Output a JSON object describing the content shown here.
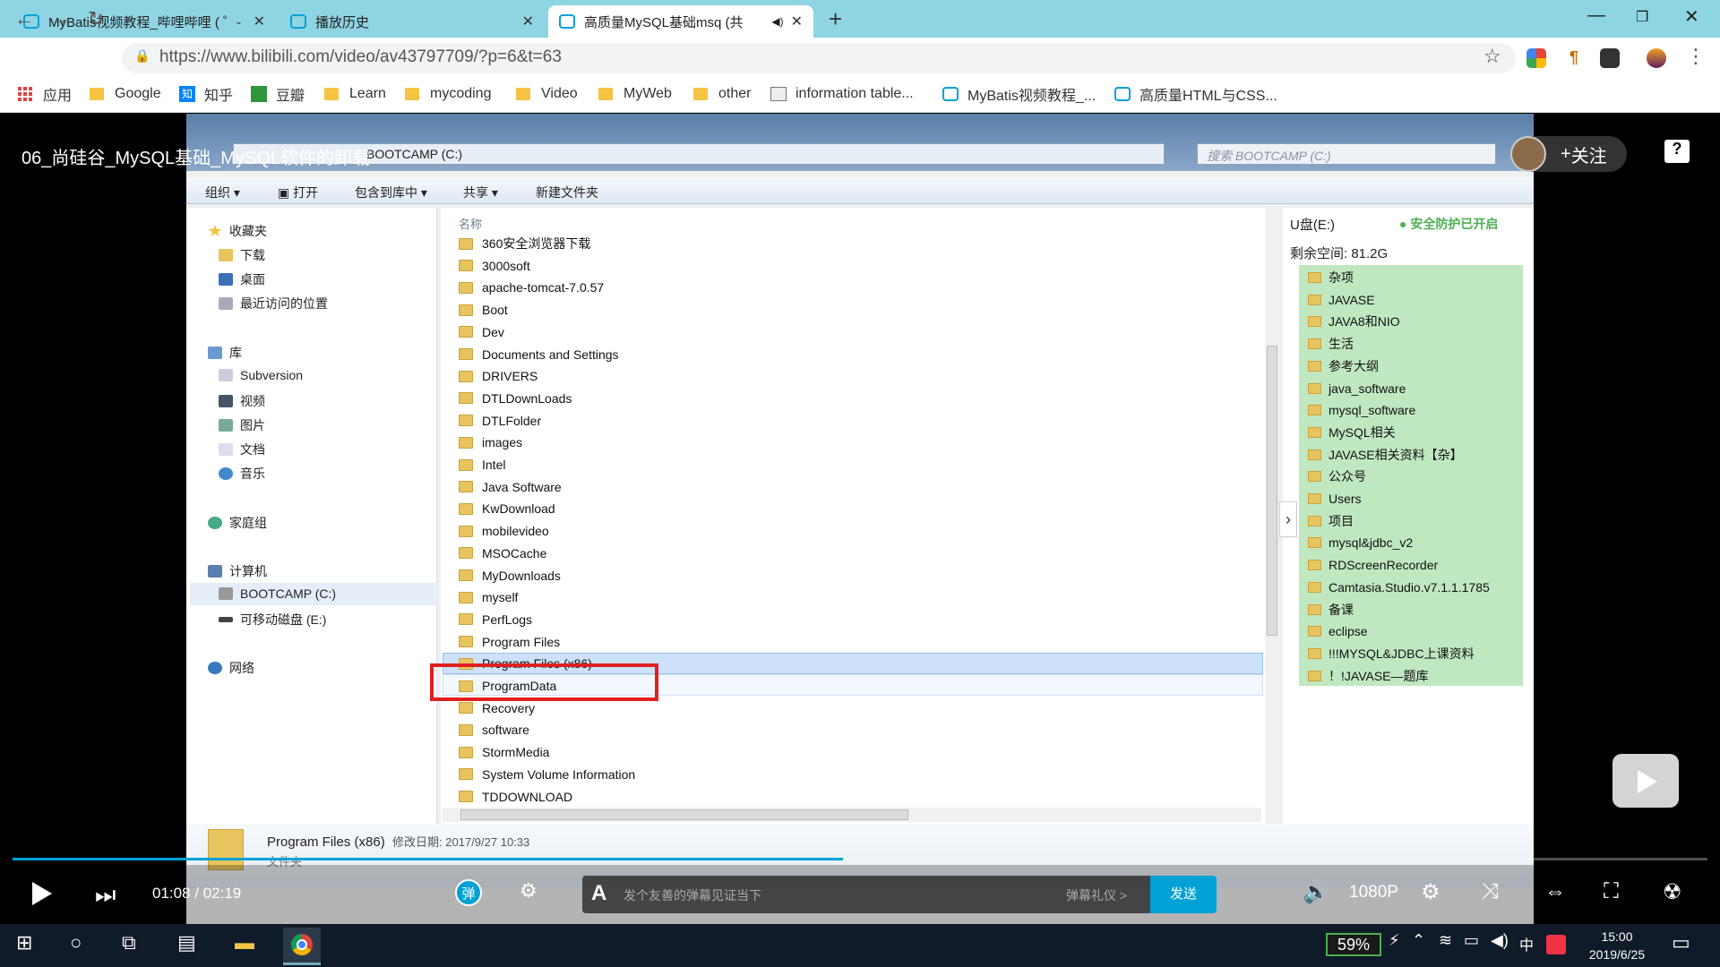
{
  "browser": {
    "tabs": [
      {
        "label": "MyBatis视频教程_哔哩哔哩 ( ゜-"
      },
      {
        "label": "播放历史"
      },
      {
        "label": "高质量MySQL基础msq (共"
      }
    ],
    "url": "https://www.bilibili.com/video/av43797709/?p=6&t=63",
    "bookmarks": [
      "应用",
      "Google",
      "知乎",
      "豆瓣",
      "Learn",
      "mycoding",
      "Video",
      "MyWeb",
      "other",
      "information table...",
      "MyBatis视频教程_...",
      "高质量HTML与CSS..."
    ]
  },
  "player": {
    "title": "06_尚硅谷_MySQL基础_MySQL软件的卸载",
    "follow_label": "关注",
    "help_label": "?",
    "time": "01:08 / 02:19",
    "progress": 0.49,
    "danmu_label": "弹",
    "danmu_placeholder": "发个友善的弹幕见证当下",
    "danmu_gift": "弹幕礼仪 >",
    "send_label": "发送",
    "quality": "1080P"
  },
  "explorer": {
    "address": "BOOTCAMP (C:)",
    "search_placeholder": "搜索 BOOTCAMP (C:)",
    "commands": [
      "组织 ▾",
      "打开",
      "包含到库中 ▾",
      "共享 ▾",
      "新建文件夹"
    ],
    "nav": {
      "favorites": "收藏夹",
      "fav_items": [
        "下载",
        "桌面",
        "最近访问的位置"
      ],
      "libraries": "库",
      "lib_items": [
        "Subversion",
        "视频",
        "图片",
        "文档",
        "音乐"
      ],
      "homegroup": "家庭组",
      "computer": "计算机",
      "drives": [
        "BOOTCAMP (C:)",
        "可移动磁盘 (E:)"
      ],
      "network": "网络"
    },
    "column_name": "名称",
    "files": [
      "360安全浏览器下载",
      "3000soft",
      "apache-tomcat-7.0.57",
      "Boot",
      "Dev",
      "Documents and Settings",
      "DRIVERS",
      "DTLDownLoads",
      "DTLFolder",
      "images",
      "Intel",
      "Java Software",
      "KwDownload",
      "mobilevideo",
      "MSOCache",
      "MyDownloads",
      "myself",
      "PerfLogs",
      "Program Files",
      "Program Files (x86)",
      "ProgramData",
      "Recovery",
      "software",
      "StormMedia",
      "System Volume Information",
      "TDDOWNLOAD"
    ],
    "detail_name": "Program Files (x86)",
    "detail_date": "修改日期: 2017/9/27 10:33",
    "detail_type": "文件夹"
  },
  "usb_panel": {
    "label": "U盘(E:)",
    "safe": "安全防护已开启",
    "space": "剩余空间: 81.2G",
    "items": [
      "杂项",
      "JAVASE",
      "JAVA8和NIO",
      "生活",
      "参考大纲",
      "java_software",
      "mysql_software",
      "MySQL相关",
      "JAVASE相关资料【杂】",
      "公众号",
      "Users",
      "项目",
      "mysql&jdbc_v2",
      "RDScreenRecorder",
      "Camtasia.Studio.v7.1.1.1785",
      "备课",
      "eclipse",
      "!!!MYSQL&JDBC上课资料",
      "！!JAVASE—题库"
    ]
  },
  "taskbar": {
    "battery": "59%",
    "ime": "中",
    "time": "15:00",
    "date": "2019/6/25"
  }
}
